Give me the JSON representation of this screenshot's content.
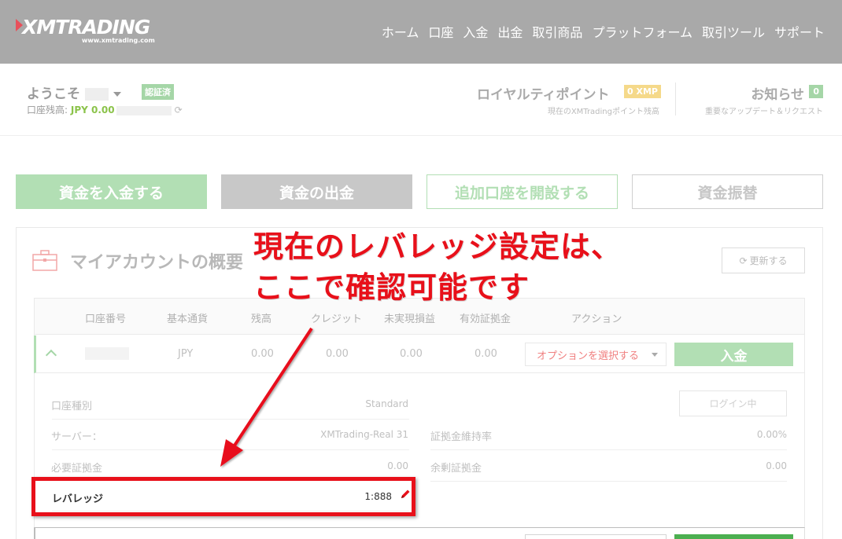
{
  "header": {
    "logo_text": "XMTRADING",
    "logo_sub": "www.xmtrading.com",
    "nav": [
      "ホーム",
      "口座",
      "入金",
      "出金",
      "取引商品",
      "プラットフォーム",
      "取引ツール",
      "サポート"
    ]
  },
  "welcome": {
    "greeting": "ようこそ",
    "verified": "認証済",
    "balance_label": "口座残高:",
    "balance_value": "JPY 0.00"
  },
  "loyalty": {
    "title": "ロイヤルティポイント",
    "badge": "0 XMP",
    "subtitle": "現在のXMTradingポイント残高"
  },
  "notice": {
    "title": "お知らせ",
    "badge": "0",
    "subtitle": "重要なアップデート＆リクエスト"
  },
  "actions": {
    "deposit": "資金を入金する",
    "withdraw": "資金の出金",
    "open_account": "追加口座を開設する",
    "transfer": "資金振替"
  },
  "panel": {
    "title": "マイアカウントの概要",
    "refresh": "更新する"
  },
  "table": {
    "headers": [
      "口座番号",
      "基本通貨",
      "残高",
      "クレジット",
      "未実現損益",
      "有効証拠金",
      "アクション"
    ],
    "row": {
      "currency": "JPY",
      "balance": "0.00",
      "credit": "0.00",
      "unrealized": "0.00",
      "equity": "0.00",
      "option_select": "オプションを選択する",
      "deposit_btn": "入金"
    }
  },
  "details": {
    "account_type_label": "口座種別",
    "account_type_value": "Standard",
    "login_btn": "ログイン中",
    "server_label": "サーバー：",
    "server_value": "XMTrading-Real 31",
    "margin_level_label": "証拠金維持率",
    "margin_level_value": "0.00%",
    "required_margin_label": "必要証拠金",
    "required_margin_value": "0.00",
    "free_margin_label": "余剰証拠金",
    "free_margin_value": "0.00",
    "leverage_label": "レバレッジ",
    "leverage_value": "1:888"
  },
  "annotation": {
    "line1": "現在のレバレッジ設定は、",
    "line2": "ここで確認可能です",
    "color": "#e8101a"
  }
}
